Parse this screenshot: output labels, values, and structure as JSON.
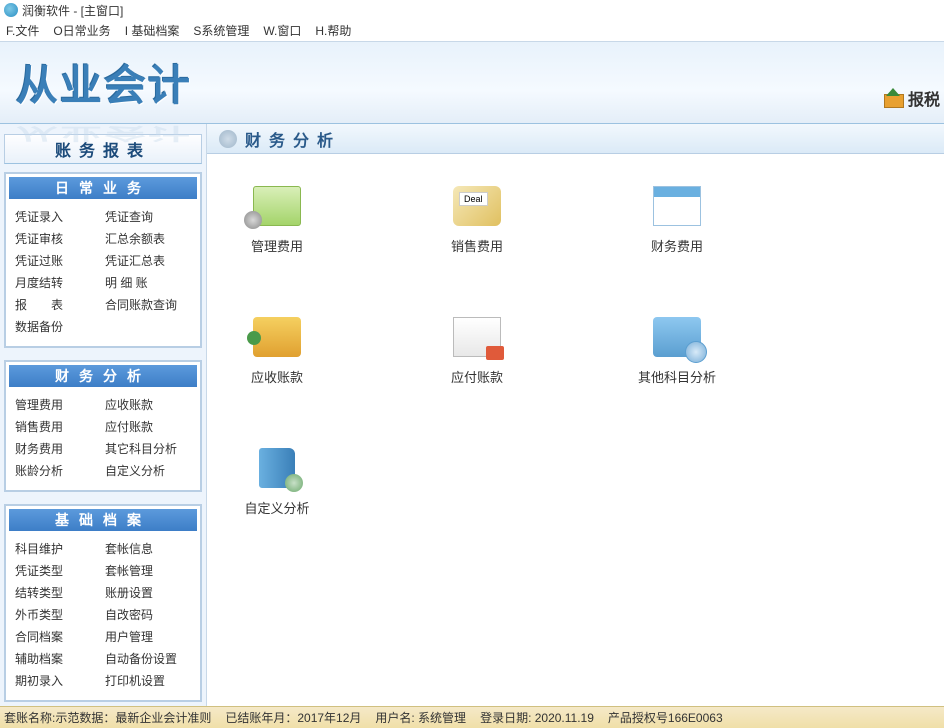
{
  "window": {
    "title": "润衡软件 - [主窗口]"
  },
  "menu": {
    "file": "F.文件",
    "daily": "O日常业务",
    "base": "I 基础档案",
    "system": "S系统管理",
    "window": "W.窗口",
    "help": "H.帮助"
  },
  "banner": {
    "logo": "从业会计",
    "tax_link": "报税"
  },
  "sidebar": {
    "tab": "账务报表",
    "groups": [
      {
        "header": "日常业务",
        "rows": [
          [
            "凭证录入",
            "凭证查询"
          ],
          [
            "凭证审核",
            "汇总余额表"
          ],
          [
            "凭证过账",
            "凭证汇总表"
          ],
          [
            "月度结转",
            "明 细 账"
          ],
          [
            "报　　表",
            "合同账款查询"
          ],
          [
            "数据备份",
            ""
          ]
        ]
      },
      {
        "header": "财务分析",
        "rows": [
          [
            "管理费用",
            "应收账款"
          ],
          [
            "销售费用",
            "应付账款"
          ],
          [
            "财务费用",
            "其它科目分析"
          ],
          [
            "账龄分析",
            "自定义分析"
          ]
        ]
      },
      {
        "header": "基础档案",
        "rows": [
          [
            "科目维护",
            "套帐信息"
          ],
          [
            "凭证类型",
            "套帐管理"
          ],
          [
            "结转类型",
            "账册设置"
          ],
          [
            "外币类型",
            "自改密码"
          ],
          [
            "合同档案",
            "用户管理"
          ],
          [
            "辅助档案",
            "自动备份设置"
          ],
          [
            "期初录入",
            "打印机设置"
          ]
        ]
      }
    ]
  },
  "content": {
    "title": "财务分析",
    "items": [
      {
        "label": "管理费用",
        "icon": "ic-mgmt"
      },
      {
        "label": "销售费用",
        "icon": "ic-sale"
      },
      {
        "label": "财务费用",
        "icon": "ic-fin"
      },
      {
        "label": "应收账款",
        "icon": "ic-recv"
      },
      {
        "label": "应付账款",
        "icon": "ic-pay"
      },
      {
        "label": "其他科目分析",
        "icon": "ic-other"
      },
      {
        "label": "自定义分析",
        "icon": "ic-custom"
      }
    ]
  },
  "statusbar": {
    "account": "套账名称:示范数据：最新企业会计准则",
    "closed": "已结账年月：2017年12月",
    "user": "用户名: 系统管理",
    "login": "登录日期: 2020.11.19",
    "license": "产品授权号166E0063"
  }
}
